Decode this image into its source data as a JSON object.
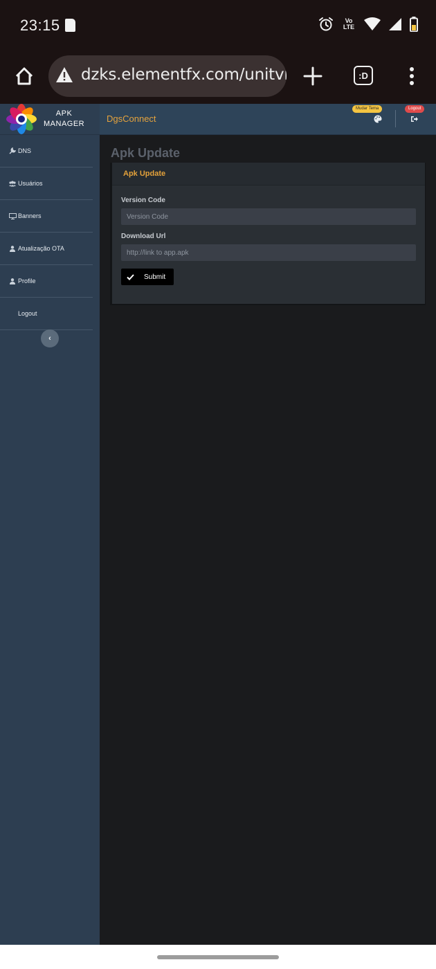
{
  "status_bar": {
    "time": "23:15",
    "network_label_top": "Vo",
    "network_label_bottom": "LTE"
  },
  "browser": {
    "url": "dzks.elementfx.com/unitvip",
    "tabs_label": ":D"
  },
  "sidebar": {
    "brand_line1": "APK",
    "brand_line2": "MANAGER",
    "items": [
      {
        "label": "DNS",
        "icon": "wrench-icon"
      },
      {
        "label": "Usuários",
        "icon": "users-icon"
      },
      {
        "label": "Banners",
        "icon": "monitor-icon"
      },
      {
        "label": "Atualização OTA",
        "icon": "user-icon"
      },
      {
        "label": "Profile",
        "icon": "user-icon"
      },
      {
        "label": "Logout",
        "icon": ""
      }
    ],
    "collapse_label": "‹"
  },
  "topbar": {
    "title": "DgsConnect",
    "theme_badge": "Mudar Tema",
    "logout_badge": "Logout"
  },
  "main": {
    "page_title": "Apk Update",
    "card": {
      "title": "Apk Update",
      "version_label": "Version Code",
      "version_placeholder": "Version Code",
      "url_label": "Download Url",
      "url_placeholder": "http://link to app.apk",
      "submit_label": "Submit"
    }
  },
  "colors": {
    "accent": "#e5a33d",
    "sidebar": "#2d3e51",
    "topbar": "#2e4459",
    "content_bg": "#1a1b1d",
    "theme_badge": "#f5c542",
    "logout_badge": "#e04b4b"
  }
}
